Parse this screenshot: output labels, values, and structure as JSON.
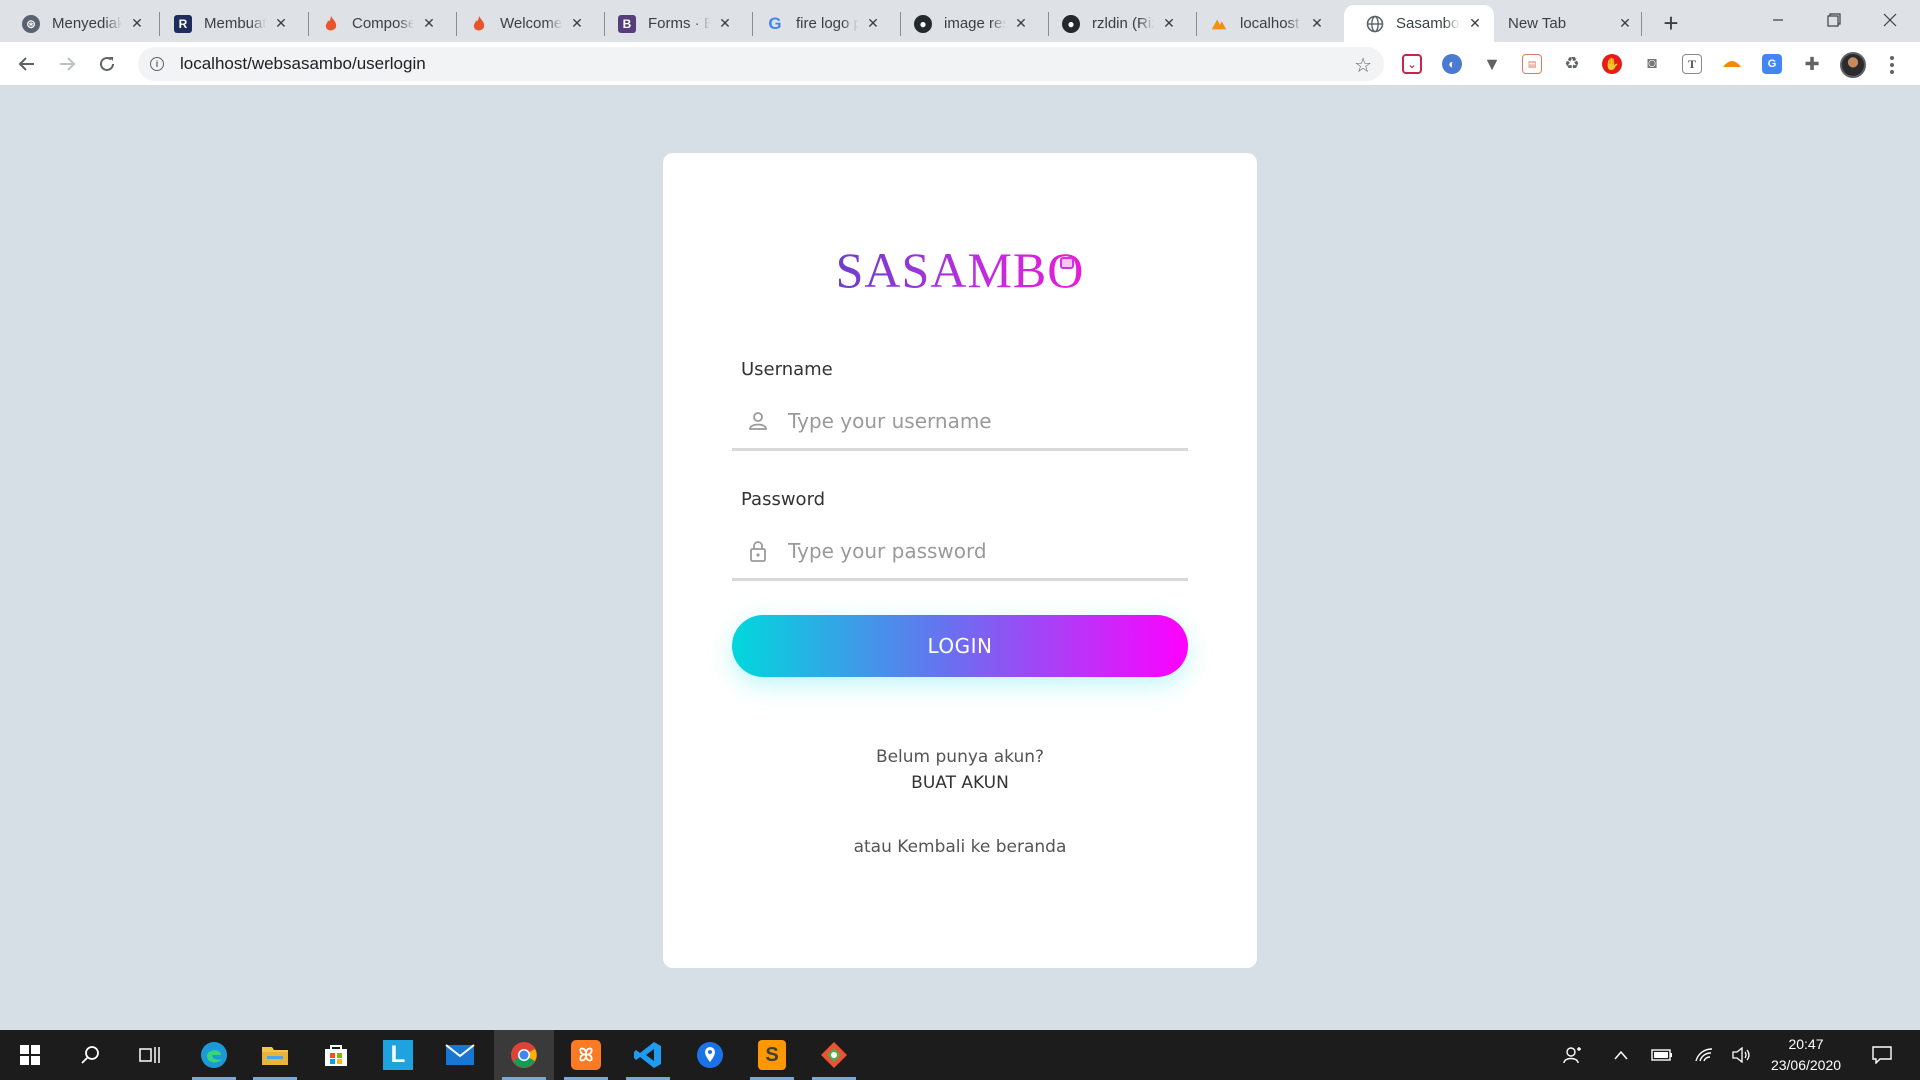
{
  "browser": {
    "tabs": [
      {
        "title": "Menyediakan",
        "favicon": "readme-icon",
        "color": "#24292e"
      },
      {
        "title": "Membuat",
        "favicon": "r-icon",
        "color": "#1f2d5c"
      },
      {
        "title": "Composer",
        "favicon": "fire-icon",
        "color": "#e8542c"
      },
      {
        "title": "Welcome t",
        "favicon": "fire-icon",
        "color": "#e8542c"
      },
      {
        "title": "Forms · Bo",
        "favicon": "bootstrap-icon",
        "color": "#563d7c"
      },
      {
        "title": "fire logo p",
        "favicon": "google-icon",
        "color": "#4285f4"
      },
      {
        "title": "image resi",
        "favicon": "github-icon",
        "color": "#24292e"
      },
      {
        "title": "rzldin (Riz",
        "favicon": "github-icon",
        "color": "#24292e"
      },
      {
        "title": "localhost /",
        "favicon": "phpmyadmin-icon",
        "color": "#f29111"
      },
      {
        "title": "Sasambo",
        "favicon": "globe-icon",
        "color": "#5f6368"
      },
      {
        "title": "New Tab",
        "favicon": "",
        "color": ""
      }
    ],
    "active_tab_index": 9,
    "url": "localhost/websasambo/userlogin"
  },
  "login": {
    "logo_text": "SASAMBO",
    "username_label": "Username",
    "username_placeholder": "Type your username",
    "password_label": "Password",
    "password_placeholder": "Type your password",
    "login_button": "LOGIN",
    "no_account_text": "Belum punya akun?",
    "signup_link": "BUAT AKUN",
    "back_home_text": "atau Kembali ke beranda"
  },
  "colors": {
    "page_background": "#d6dee6",
    "button_gradient_start": "#00d8dc",
    "button_gradient_end": "#ff00ff",
    "logo_gradient": "#c02ce0"
  },
  "taskbar": {
    "time": "20:47",
    "date": "23/06/2020"
  }
}
